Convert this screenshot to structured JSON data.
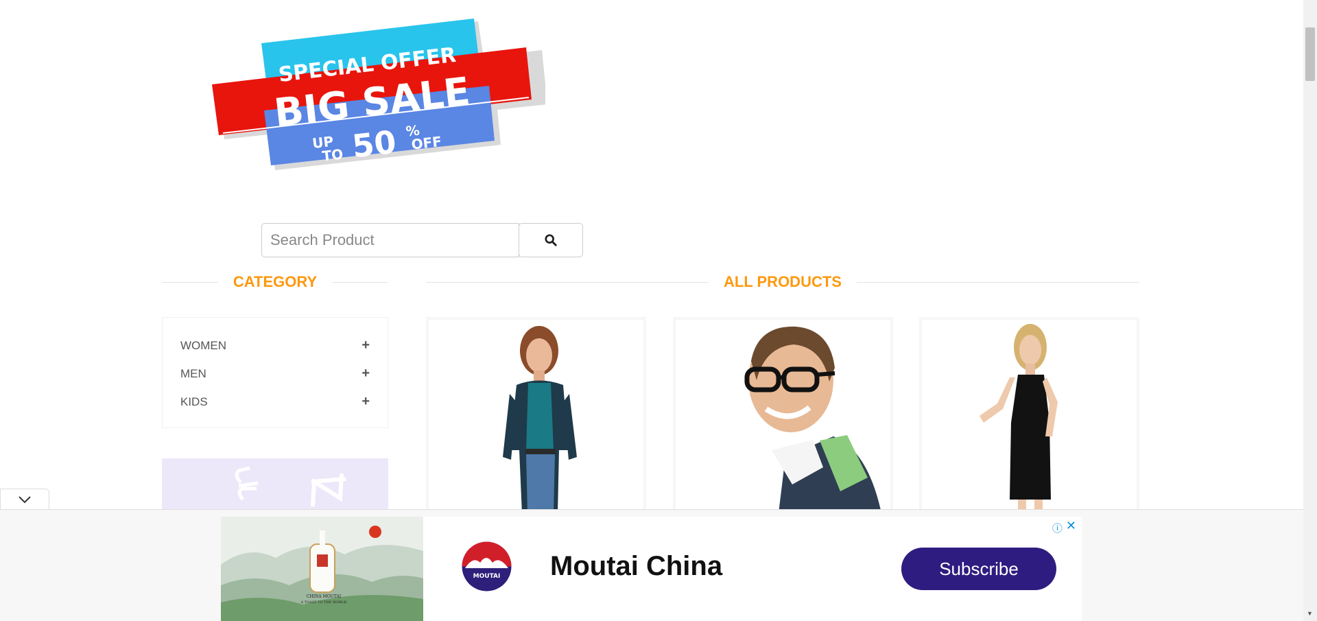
{
  "banner": {
    "line1": "SPECIAL OFFER",
    "line2": "BIG SALE",
    "line3_up": "UP",
    "line3_to": "TO",
    "line3_num": "50",
    "line3_pct": "%",
    "line3_off": "OFF"
  },
  "search": {
    "placeholder": "Search Product",
    "button_icon": "search-icon"
  },
  "sections": {
    "category_title": "CATEGORY",
    "products_title": "ALL PRODUCTS"
  },
  "categories": [
    {
      "label": "WOMEN",
      "icon": "plus-icon"
    },
    {
      "label": "MEN",
      "icon": "plus-icon"
    },
    {
      "label": "KIDS",
      "icon": "plus-icon"
    }
  ],
  "products": [
    {
      "image": "woman-in-cardigan-photo"
    },
    {
      "image": "man-with-glasses-photo"
    },
    {
      "image": "woman-in-black-dress-photo"
    }
  ],
  "ad": {
    "name": "Moutai China",
    "cta": "Subscribe",
    "logo_text": "MOUTAI",
    "image_caption_line1": "CHINA MOUTAI",
    "image_caption_line2": "A TOAST TO THE WORLD",
    "info_icon": "info-icon",
    "close_icon": "close-icon"
  },
  "colors": {
    "accent": "#fe980f",
    "ad_button": "#2f1c80",
    "banner_cyan": "#29c4ec",
    "banner_red": "#e8150d",
    "banner_blue": "#5a86e4"
  }
}
